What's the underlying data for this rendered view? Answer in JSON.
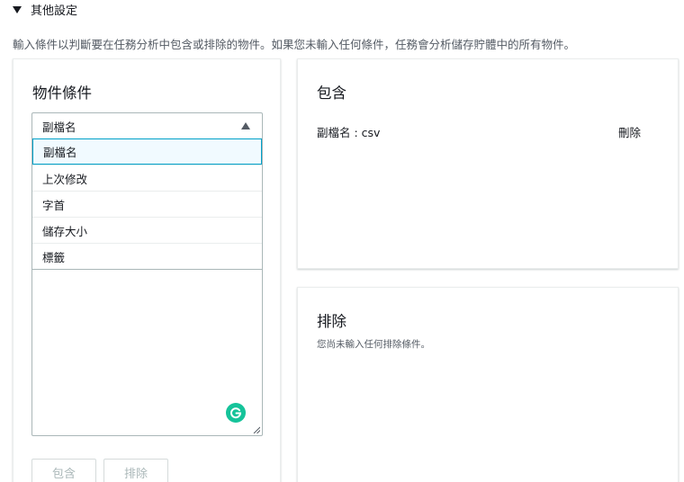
{
  "section": {
    "title": "其他設定"
  },
  "description": "輸入條件以判斷要在任務分析中包含或排除的物件。如果您未輸入任何條件，任務會分析儲存貯體中的所有物件。",
  "conditions_panel": {
    "title": "物件條件",
    "select_value": "副檔名",
    "options": [
      "副檔名",
      "上次修改",
      "字首",
      "儲存大小",
      "標籤"
    ],
    "buttons": {
      "include": "包含",
      "exclude": "排除"
    }
  },
  "include_panel": {
    "title": "包含",
    "condition": "副檔名 : csv",
    "delete_label": "刪除"
  },
  "exclude_panel": {
    "title": "排除",
    "empty_text": "您尚未輸入任何排除條件。"
  },
  "colors": {
    "accent": "#00a1c9",
    "grammarly": "#15c39a"
  }
}
